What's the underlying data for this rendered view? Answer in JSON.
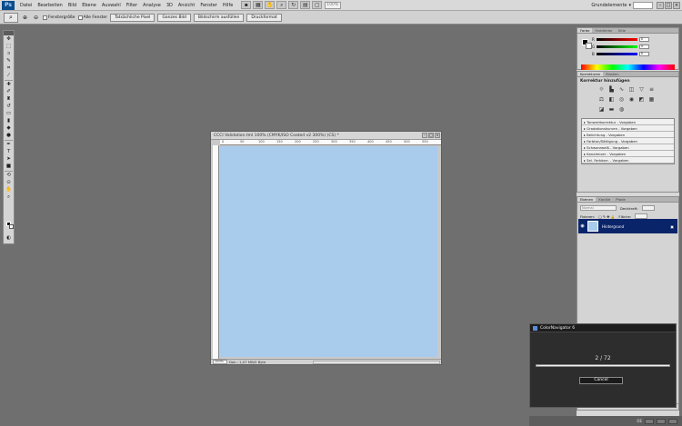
{
  "app": {
    "logo": "Ps"
  },
  "menu": [
    "Datei",
    "Bearbeiten",
    "Bild",
    "Ebene",
    "Auswahl",
    "Filter",
    "Analyse",
    "3D",
    "Ansicht",
    "Fenster",
    "Hilfe"
  ],
  "appbar": {
    "zoom": "100%",
    "workspace": "Grundelemente"
  },
  "options": {
    "cb_window_size": "Fenstergröße",
    "cb_all_windows": "Alle Fenster",
    "btn_actual_pixels": "Tatsächliche Pixel",
    "btn_fit_screen": "Ganzes Bild",
    "btn_fill_screen": "Bildschirm ausfüllen",
    "btn_print_size": "Druckformat"
  },
  "document": {
    "title": "CCCI Validation.tml 100% (CMYK/ISO Coated v2 300%) (CS) *",
    "ruler_marks": [
      "0",
      "50",
      "100",
      "150",
      "200",
      "250",
      "300",
      "350",
      "400",
      "450",
      "500",
      "550"
    ],
    "zoom": "100%",
    "status": "Dok.: 1,07 MB/0 Byte",
    "canvas_color": "#a9cbec"
  },
  "panels": {
    "color_tabs": [
      "Farbe",
      "Farbfelder",
      "Stile"
    ],
    "color_sliders": [
      {
        "label": "R",
        "value": "0"
      },
      {
        "label": "G",
        "value": "0"
      },
      {
        "label": "B",
        "value": "0"
      }
    ],
    "adjust_tabs": [
      "Korrekturen",
      "Masken"
    ],
    "adjust_title": "Korrektur hinzufügen",
    "presets": [
      "Tonwertkorrektur - Vorgaben",
      "Gradationskurven - Vorgaben",
      "Belichtung - Vorgaben",
      "Farbton/Sättigung - Vorgaben",
      "Schwarzweiß - Vorgaben",
      "Kanalmixer - Vorgaben",
      "Sel. Farbkorr. - Vorgaben"
    ],
    "layers_tabs": [
      "Ebenen",
      "Kanäle",
      "Pfade"
    ],
    "layers_mode": "Normal",
    "layers_opacity_label": "Deckkraft:",
    "layers_lock_label": "Fixieren:",
    "layers_fill_label": "Fläche:",
    "layer_name": "Hintergrund"
  },
  "dialog": {
    "title": "ColorNavigator 6",
    "counter": "2 / 72",
    "progress": 0.03,
    "cancel": "Cancel"
  },
  "taskbar": {
    "lang": "DE"
  }
}
